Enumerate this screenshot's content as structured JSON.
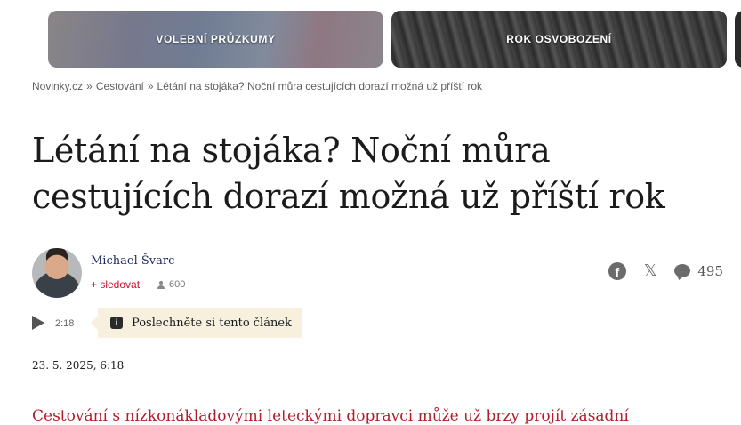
{
  "topics": {
    "tile1": "VOLEBNÍ PRŮZKUMY",
    "tile2": "ROK OSVOBOZENÍ"
  },
  "breadcrumb": {
    "items": [
      "Novinky.cz",
      "Cestování",
      "Létání na stojáka? Noční můra cestujících dorazí možná už příští rok"
    ],
    "separator": "»"
  },
  "article": {
    "title": "Létání na stojáka? Noční můra cestujících dorazí možná už příští rok",
    "author": "Michael Švarc",
    "follow_label": "+ sledovat",
    "followers": "600",
    "comments": "495",
    "audio_duration": "2:18",
    "listen_label": "Poslechněte si tento článek",
    "date": "23. 5. 2025, 6:18",
    "lead": "Cestování s nízkonákladovými leteckými dopravci může už brzy projít zásadní"
  },
  "icons": {
    "share": [
      "facebook-icon",
      "x-icon",
      "comment-icon"
    ],
    "play": "play-icon",
    "info": "info-icon",
    "followers": "person-icon"
  },
  "colors": {
    "accent": "#c8102e",
    "lead": "#b01e2a",
    "listen_bg": "#f7f0df"
  }
}
